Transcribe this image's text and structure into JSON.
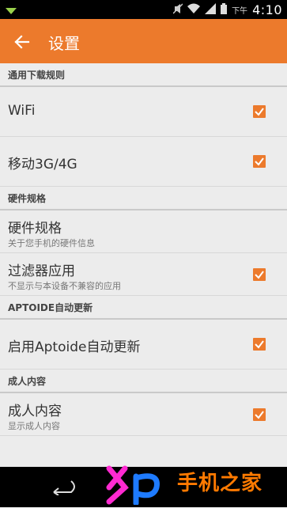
{
  "status_bar": {
    "time": "4:10",
    "time_prefix": "下午"
  },
  "app_bar": {
    "title": "设置"
  },
  "sections": [
    {
      "header": "通用下载规则",
      "items": [
        {
          "label": "WiFi",
          "checked": true
        },
        {
          "label": "移动3G/4G",
          "checked": true
        }
      ]
    },
    {
      "header": "硬件规格",
      "items": [
        {
          "label": "硬件规格",
          "sub": "关于您手机的硬件信息",
          "checked": null
        },
        {
          "label": "过滤器应用",
          "sub": "不显示与本设备不兼容的应用",
          "checked": true
        }
      ]
    },
    {
      "header": "APTOIDE自动更新",
      "items": [
        {
          "label": "启用Aptoide自动更新",
          "checked": true
        }
      ]
    },
    {
      "header": "成人内容",
      "items": [
        {
          "label": "成人内容",
          "sub": "显示成人内容",
          "checked": true
        }
      ]
    }
  ],
  "watermark": {
    "logo": "Xp",
    "text": "手机之家"
  },
  "colors": {
    "accent": "#ec7a2c",
    "status_bar": "#000000",
    "background": "#ececec"
  }
}
